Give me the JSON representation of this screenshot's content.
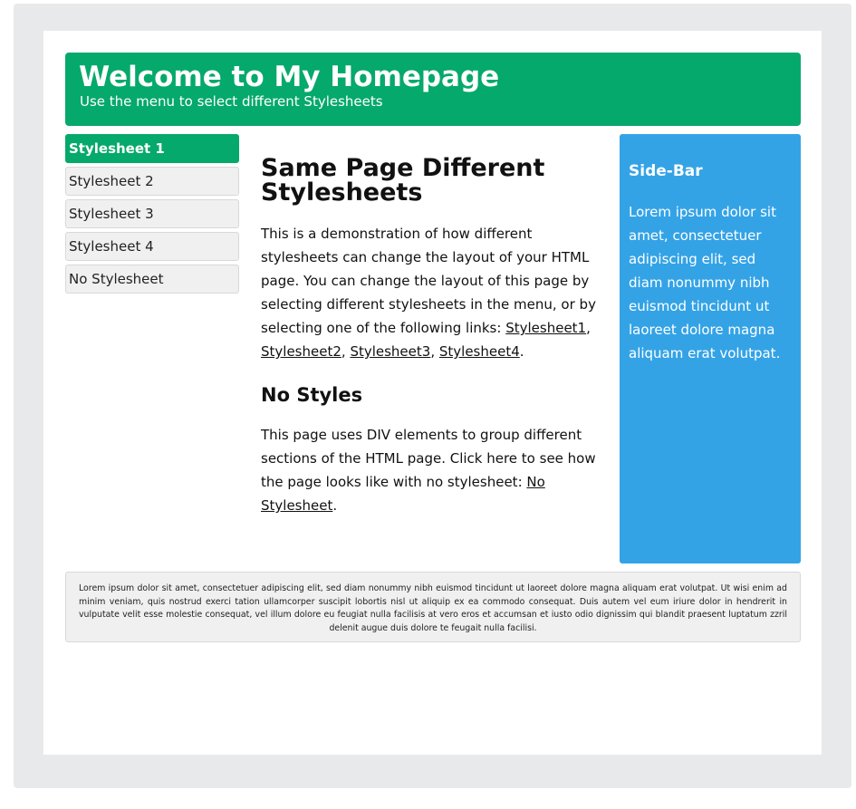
{
  "header": {
    "title": "Welcome to My Homepage",
    "subtitle": "Use the menu to select different Stylesheets"
  },
  "menu": {
    "items": [
      {
        "label": "Stylesheet 1",
        "active": true
      },
      {
        "label": "Stylesheet 2",
        "active": false
      },
      {
        "label": "Stylesheet 3",
        "active": false
      },
      {
        "label": "Stylesheet 4",
        "active": false
      },
      {
        "label": "No Stylesheet",
        "active": false
      }
    ]
  },
  "main": {
    "heading": "Same Page Different Stylesheets",
    "intro": "This is a demonstration of how different stylesheets can change the layout of your HTML page. You can change the layout of this page by selecting different stylesheets in the menu, or by selecting one of the following links:",
    "links": [
      "Stylesheet1",
      "Stylesheet2",
      "Stylesheet3",
      "Stylesheet4"
    ],
    "sep": ", ",
    "end": ".",
    "subheading": "No Styles",
    "text2": "This page uses DIV elements to group different sections of the HTML page. Click here to see how the page looks like with no stylesheet:",
    "link_no_style": "No Stylesheet"
  },
  "sidebar": {
    "title": "Side-Bar",
    "text": "Lorem ipsum dolor sit amet, consectetuer adipiscing elit, sed diam nonummy nibh euismod tincidunt ut laoreet dolore magna aliquam erat volutpat."
  },
  "footer": {
    "text": "Lorem ipsum dolor sit amet, consectetuer adipiscing elit, sed diam nonummy nibh euismod tincidunt ut laoreet dolore magna aliquam erat volutpat. Ut wisi enim ad minim veniam, quis nostrud exerci tation ullamcorper suscipit lobortis nisl ut aliquip ex ea commodo consequat. Duis autem vel eum iriure dolor in hendrerit in vulputate velit esse molestie consequat, vel illum dolore eu feugiat nulla facilisis at vero eros et accumsan et iusto odio dignissim qui blandit praesent luptatum zzril delenit augue duis dolore te feugait nulla facilisi."
  },
  "colors": {
    "header_bg": "#05a96b",
    "sidebar_bg": "#34a3e6",
    "frame_bg": "#e8e9ea",
    "menu_bg": "#f0f0f0"
  }
}
